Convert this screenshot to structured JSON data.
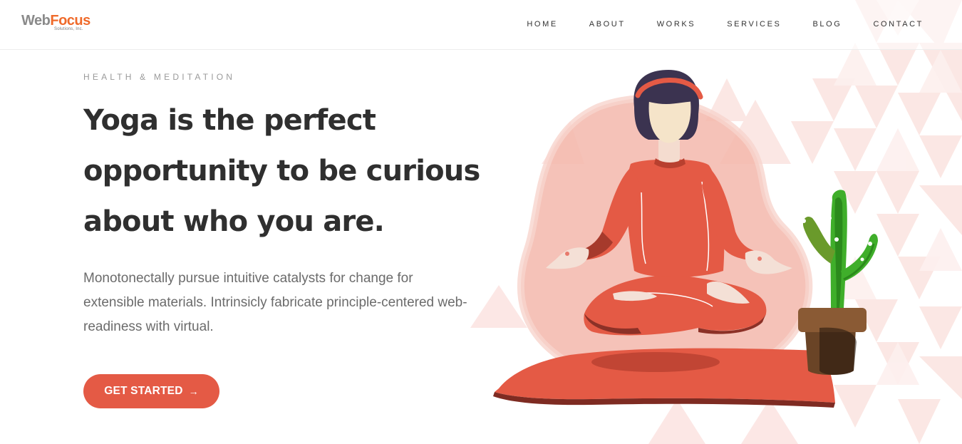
{
  "brand": {
    "logo_main_1": "Web",
    "logo_main_2": "Focus",
    "logo_sub": "Solutions, Inc.",
    "color_gray": "#8a8a8a",
    "color_orange": "#ef6a2a"
  },
  "nav": {
    "items": [
      {
        "label": "HOME"
      },
      {
        "label": "ABOUT"
      },
      {
        "label": "WORKS"
      },
      {
        "label": "SERVICES"
      },
      {
        "label": "BLOG"
      },
      {
        "label": "CONTACT"
      }
    ]
  },
  "hero": {
    "eyebrow": "HEALTH & MEDITATION",
    "headline": "Yoga is the perfect opportunity to be curious about who you are.",
    "description": "Monotonectally pursue intuitive catalysts for change for extensible materials. Intrinsicly fabricate principle-centered web-readiness with virtual.",
    "cta_label": "GET STARTED",
    "cta_icon": "arrow-right-icon"
  },
  "colors": {
    "accent": "#e45a45",
    "blob": "#f2b3a8",
    "plant": "#3fae2a",
    "pot": "#7a4f2c"
  },
  "illustration": {
    "subject": "meditating-woman",
    "props": [
      "yoga-mat",
      "potted-cactus"
    ]
  }
}
